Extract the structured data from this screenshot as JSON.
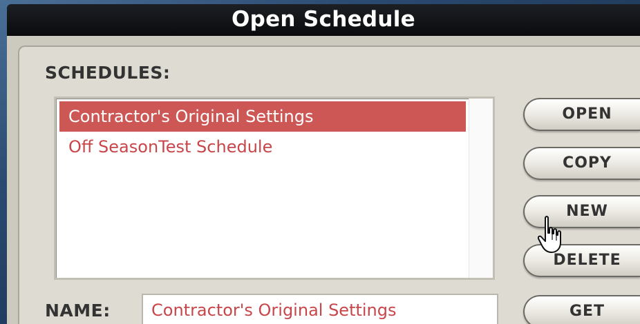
{
  "window": {
    "title": "Open Schedule"
  },
  "schedules": {
    "label": "SCHEDULES:",
    "items": [
      {
        "label": "Contractor's Original Settings",
        "selected": true
      },
      {
        "label": "Off SeasonTest Schedule",
        "selected": false
      }
    ]
  },
  "name": {
    "label": "NAME:",
    "value": "Contractor's Original Settings"
  },
  "buttons": {
    "open": "OPEN",
    "copy": "COPY",
    "new": "NEW",
    "delete": "DELETE",
    "get": "GET"
  },
  "colors": {
    "selection": "#cc5754",
    "item_text": "#c8464a",
    "panel": "#dedbd2",
    "title_bar": "#0f1115"
  },
  "icons": {
    "cursor": "hand-pointer-icon"
  }
}
